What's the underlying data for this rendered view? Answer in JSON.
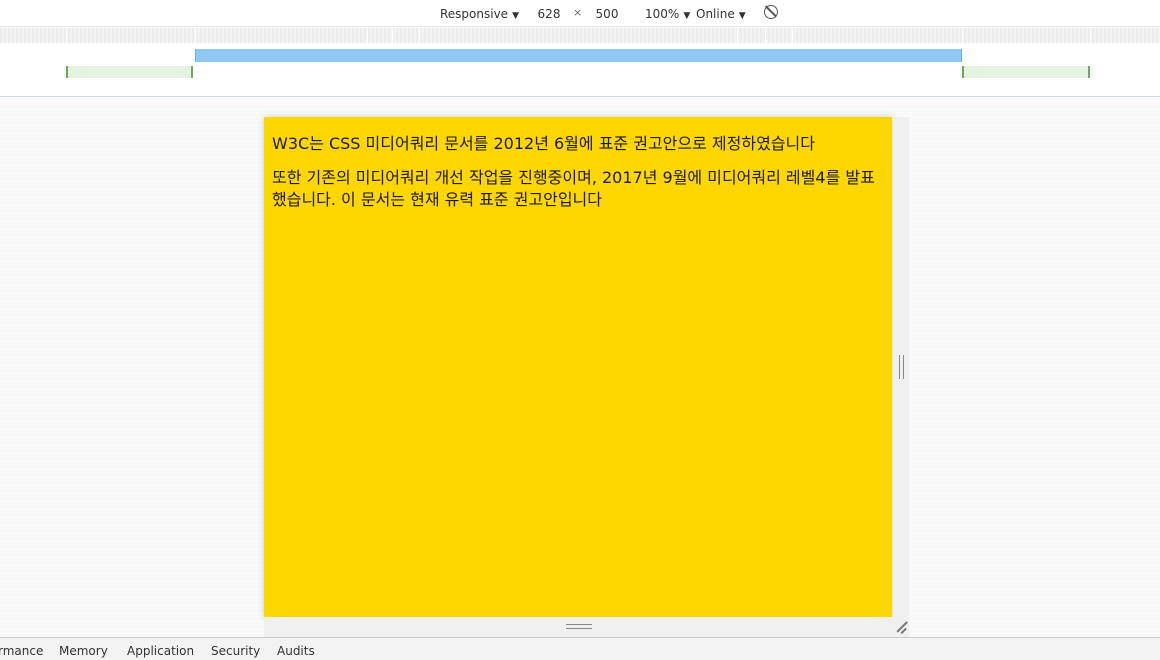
{
  "toolbar": {
    "device": "Responsive",
    "width": "628",
    "times": "×",
    "height": "500",
    "zoom": "100%",
    "throttle": "Online",
    "rotate_icon": "rotate-icon"
  },
  "content": {
    "paragraphs": [
      "W3C는 CSS 미디어쿼리 문서를 2012년 6월에 표준 권고안으로 제정하였습니다",
      "또한 기존의 미디어쿼리 개선 작업을 진행중이며, 2017년 9월에 미디어쿼리 레벨4를 발표했습니다. 이 문서는 현재 유력 표준 권고안입니다"
    ],
    "background": "#ffd700"
  },
  "tabs": [
    {
      "label": "rmance"
    },
    {
      "label": "Memory"
    },
    {
      "label": "Application"
    },
    {
      "label": "Security"
    },
    {
      "label": "Audits"
    }
  ],
  "colors": {
    "media_query_max": "#8fc8f2",
    "media_query_min": "#e4f3e2"
  }
}
